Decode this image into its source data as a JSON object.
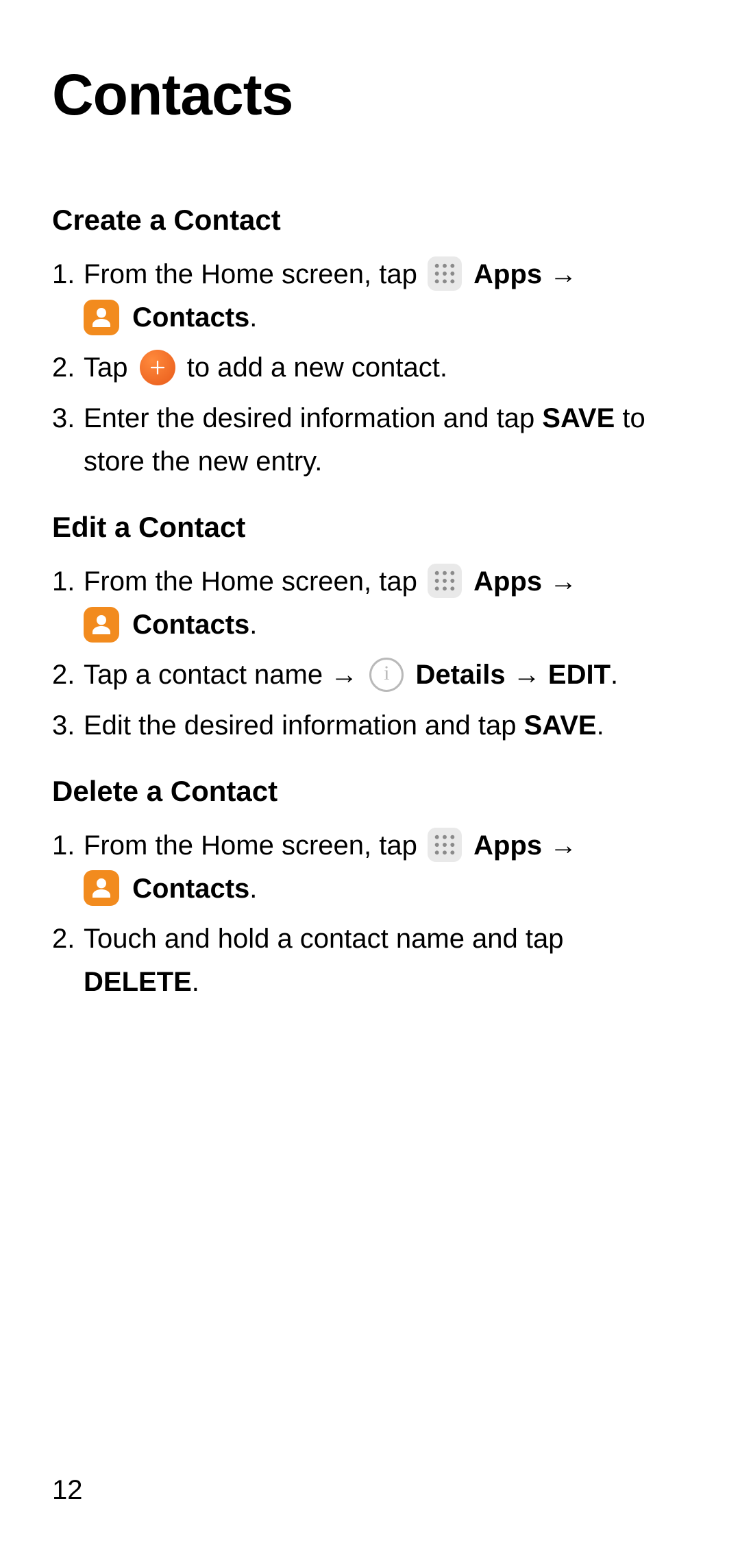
{
  "title": "Contacts",
  "page_number": "12",
  "arrow": "→",
  "labels": {
    "apps": "Apps",
    "contacts": "Contacts",
    "details": "Details",
    "edit": "EDIT",
    "save": "SAVE",
    "delete": "DELETE"
  },
  "text": {
    "from_home": "From the Home screen, tap ",
    "period": ".",
    "tap": "Tap ",
    "to_add": " to add a new contact.",
    "enter_info": "Enter the desired information and tap ",
    "store_entry": " to store the new entry.",
    "tap_contact_name": "Tap a contact name ",
    "edit_info": "Edit the desired information and tap ",
    "touch_hold": "Touch and hold a contact name and tap "
  },
  "sections": {
    "create": "Create a Contact",
    "edit": "Edit a Contact",
    "delete": "Delete a Contact"
  }
}
